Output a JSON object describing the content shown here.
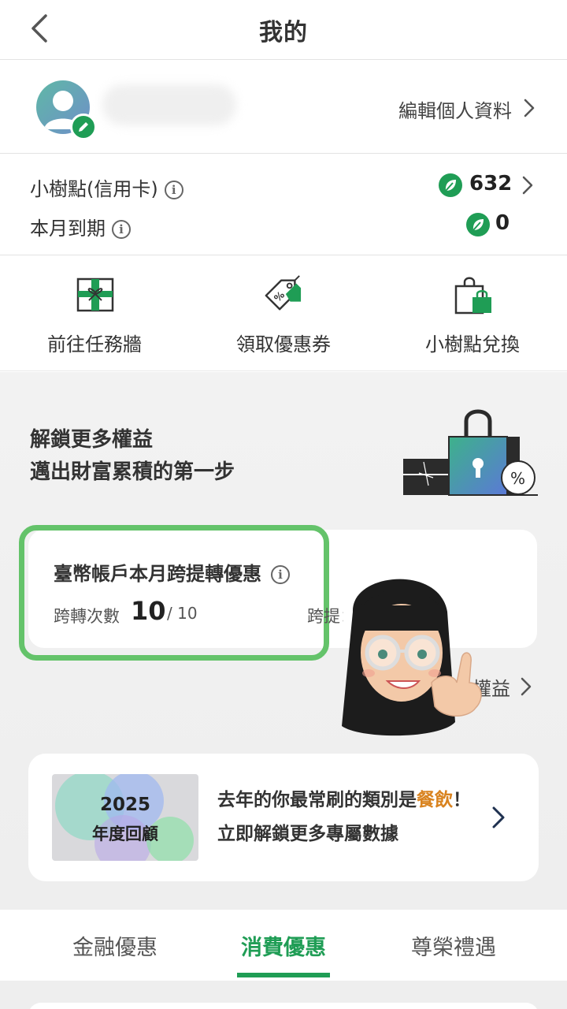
{
  "header": {
    "title": "我的",
    "back_icon": "chevron-left-icon"
  },
  "profile": {
    "edit_label": "編輯個人資料",
    "avatar_icon": "user-avatar-icon",
    "edit_badge_icon": "pencil-icon"
  },
  "points": {
    "credit_label": "小樹點(信用卡)",
    "credit_value": "632",
    "expire_label": "本月到期",
    "expire_value": "0",
    "info_icon": "info-icon",
    "leaf_icon": "leaf-icon"
  },
  "actions": [
    {
      "label": "前往任務牆",
      "icon": "gift-box-icon"
    },
    {
      "label": "領取優惠券",
      "icon": "coupon-tag-icon"
    },
    {
      "label": "小樹點兌換",
      "icon": "shopping-bag-icon"
    }
  ],
  "benefits": {
    "unlock_line1": "解鎖更多權益",
    "unlock_line2": "邁出財富累積的第一步",
    "transfer_title": "臺幣帳戶本月跨提轉優惠",
    "transfer_count_label": "跨轉次數",
    "transfer_count": "10",
    "transfer_total": "/ 10",
    "transfer_label2": "跨提：",
    "more_link": "權益"
  },
  "review": {
    "year": "2025",
    "label": "年度回顧",
    "text_prefix": "去年的你最常刷的類別是",
    "text_highlight": "餐飲",
    "text_suffix": "！立即解鎖更多專屬數據"
  },
  "tabs": [
    {
      "label": "金融優惠",
      "active": false
    },
    {
      "label": "消費優惠",
      "active": true
    },
    {
      "label": "尊榮禮遇",
      "active": false
    }
  ],
  "colors": {
    "brand_green": "#1f9d55",
    "highlight_green": "#64c36a",
    "accent_orange": "#d9831f"
  }
}
